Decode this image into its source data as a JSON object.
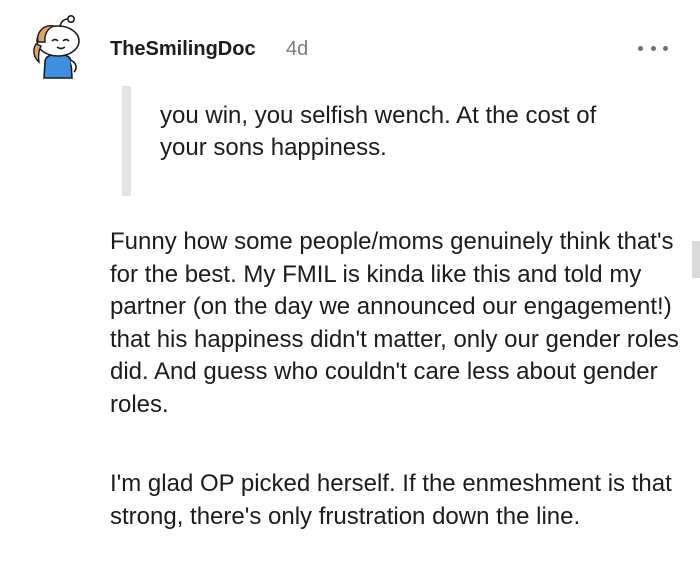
{
  "comment": {
    "author": "TheSmilingDoc",
    "timestamp": "4d",
    "avatar_icon": "snoo-avatar-icon",
    "more_icon": "more-options-icon",
    "quote": "you win, you selfish wench. At the cost of your sons happiness.",
    "paragraphs": [
      "Funny how some people/moms genuinely think that's for the best. My FMIL is kinda like this and told my partner (on the day we announced our engagement!) that his happiness didn't matter, only our gender roles did. And guess who couldn't care less about gender roles.",
      "I'm glad OP picked herself. If the enmeshment is that strong, there's only frustration down the line."
    ]
  },
  "colors": {
    "text": "#1c1c1c",
    "muted": "#7c7c7c",
    "quote_bar": "#e3e3e3",
    "avatar_shirt": "#3d8fe0"
  }
}
